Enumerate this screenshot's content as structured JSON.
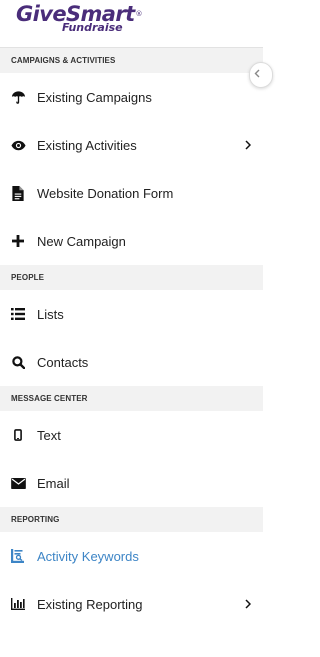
{
  "brand": {
    "name": "GiveSmart",
    "registered_mark": "®",
    "sub": "Fundraise",
    "color": "#4a2d7a"
  },
  "sidebar": {
    "collapse_icon": "chevron-left-icon",
    "sections": [
      {
        "header": "CAMPAIGNS & ACTIVITIES",
        "items": [
          {
            "label": "Existing Campaigns",
            "icon": "umbrella-icon",
            "has_submenu": false
          },
          {
            "label": "Existing Activities",
            "icon": "eye-icon",
            "has_submenu": true
          },
          {
            "label": "Website Donation Form",
            "icon": "document-icon",
            "has_submenu": false
          },
          {
            "label": "New Campaign",
            "icon": "plus-icon",
            "has_submenu": false
          }
        ]
      },
      {
        "header": "PEOPLE",
        "items": [
          {
            "label": "Lists",
            "icon": "list-icon",
            "has_submenu": false
          },
          {
            "label": "Contacts",
            "icon": "search-icon",
            "has_submenu": false
          }
        ]
      },
      {
        "header": "MESSAGE CENTER",
        "items": [
          {
            "label": "Text",
            "icon": "mobile-icon",
            "has_submenu": false
          },
          {
            "label": "Email",
            "icon": "envelope-icon",
            "has_submenu": false
          }
        ]
      },
      {
        "header": "REPORTING",
        "items": [
          {
            "label": "Activity Keywords",
            "icon": "keyword-report-icon",
            "has_submenu": false,
            "active": true
          },
          {
            "label": "Existing Reporting",
            "icon": "bar-chart-icon",
            "has_submenu": true
          }
        ]
      }
    ]
  },
  "colors": {
    "active_text": "#3d85c6",
    "section_bg": "#f2f2f2",
    "text": "#222222"
  }
}
